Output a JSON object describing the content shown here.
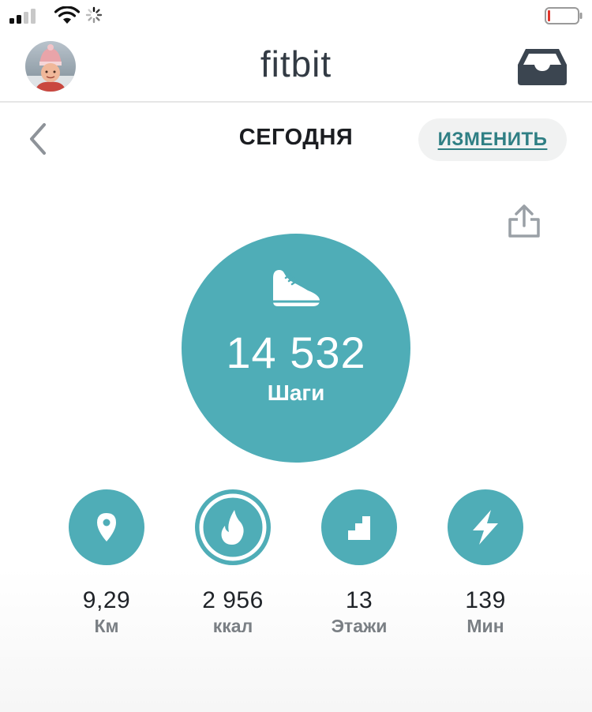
{
  "header": {
    "app_title": "fitbit"
  },
  "nav": {
    "date_title": "СЕГОДНЯ",
    "edit_label": "ИЗМЕНИТЬ"
  },
  "steps": {
    "value": "14 532",
    "label": "Шаги"
  },
  "stats": [
    {
      "icon": "location-pin-icon",
      "value": "9,29",
      "unit": "Км"
    },
    {
      "icon": "flame-icon",
      "value": "2 956",
      "unit": "ккал"
    },
    {
      "icon": "stairs-icon",
      "value": "13",
      "unit": "Этажи"
    },
    {
      "icon": "lightning-icon",
      "value": "139",
      "unit": "Мин"
    }
  ],
  "colors": {
    "accent": "#4fadb7",
    "link": "#2f7f84",
    "title": "#333b44",
    "battery_low": "#e0352b"
  }
}
